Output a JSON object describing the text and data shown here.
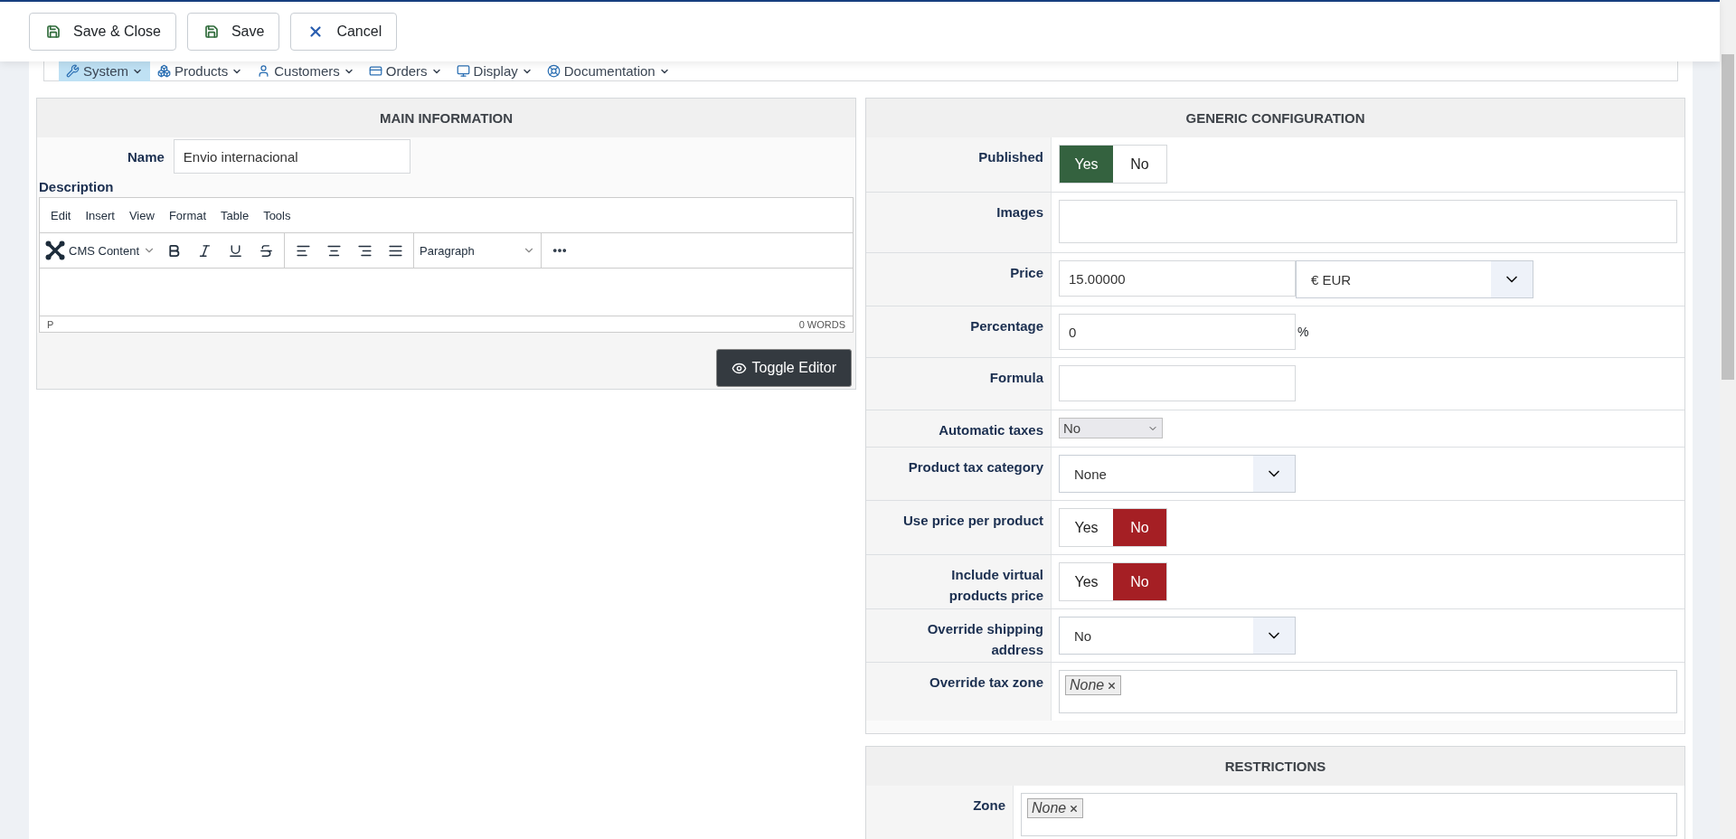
{
  "toolbar": {
    "buttons": [
      {
        "label": "Save & Close",
        "kind": "save"
      },
      {
        "label": "Save",
        "kind": "save"
      },
      {
        "label": "Cancel",
        "kind": "cancel"
      }
    ]
  },
  "menu": [
    {
      "label": "System",
      "selected": true
    },
    {
      "label": "Products",
      "selected": false
    },
    {
      "label": "Customers",
      "selected": false
    },
    {
      "label": "Orders",
      "selected": false
    },
    {
      "label": "Display",
      "selected": false
    },
    {
      "label": "Documentation",
      "selected": false
    }
  ],
  "main_information": {
    "title": "MAIN INFORMATION",
    "name_label": "Name",
    "name_value": "Envio internacional",
    "description_label": "Description",
    "editor": {
      "menubar": [
        "Edit",
        "Insert",
        "View",
        "Format",
        "Table",
        "Tools"
      ],
      "format_select": "CMS Content",
      "block_select": "Paragraph",
      "path": "P",
      "word_count": "0 WORDS"
    },
    "toggle_button": "Toggle Editor"
  },
  "generic_configuration": {
    "title": "GENERIC CONFIGURATION",
    "rows": [
      {
        "label": "Published",
        "kind": "toggle",
        "options": [
          {
            "label": "Yes",
            "selected": true
          },
          {
            "label": "No",
            "selected": false
          }
        ]
      },
      {
        "label": "Images",
        "kind": "wide_text"
      },
      {
        "label": "Price",
        "kind": "price",
        "value": "15.00000",
        "currency": "€ EUR"
      },
      {
        "label": "Percentage",
        "kind": "percent",
        "value": "0",
        "suffix": "%"
      },
      {
        "label": "Formula",
        "kind": "text"
      },
      {
        "label": "Automatic taxes",
        "kind": "small_select",
        "value": "No"
      },
      {
        "label": "Product tax category",
        "kind": "select",
        "value": "None"
      },
      {
        "label": "Use price per product",
        "kind": "toggle",
        "options": [
          {
            "label": "Yes",
            "selected": false
          },
          {
            "label": "No",
            "selected": true
          }
        ]
      },
      {
        "label": "Include virtual products price",
        "kind": "toggle",
        "options": [
          {
            "label": "Yes",
            "selected": false
          },
          {
            "label": "No",
            "selected": true
          }
        ]
      },
      {
        "label": "Override shipping address",
        "kind": "select",
        "value": "No"
      },
      {
        "label": "Override tax zone",
        "kind": "tags",
        "tags": [
          "None"
        ]
      }
    ]
  },
  "restrictions": {
    "title": "RESTRICTIONS",
    "rows": [
      {
        "label": "Zone",
        "kind": "tags",
        "tags": [
          "None"
        ]
      }
    ]
  }
}
